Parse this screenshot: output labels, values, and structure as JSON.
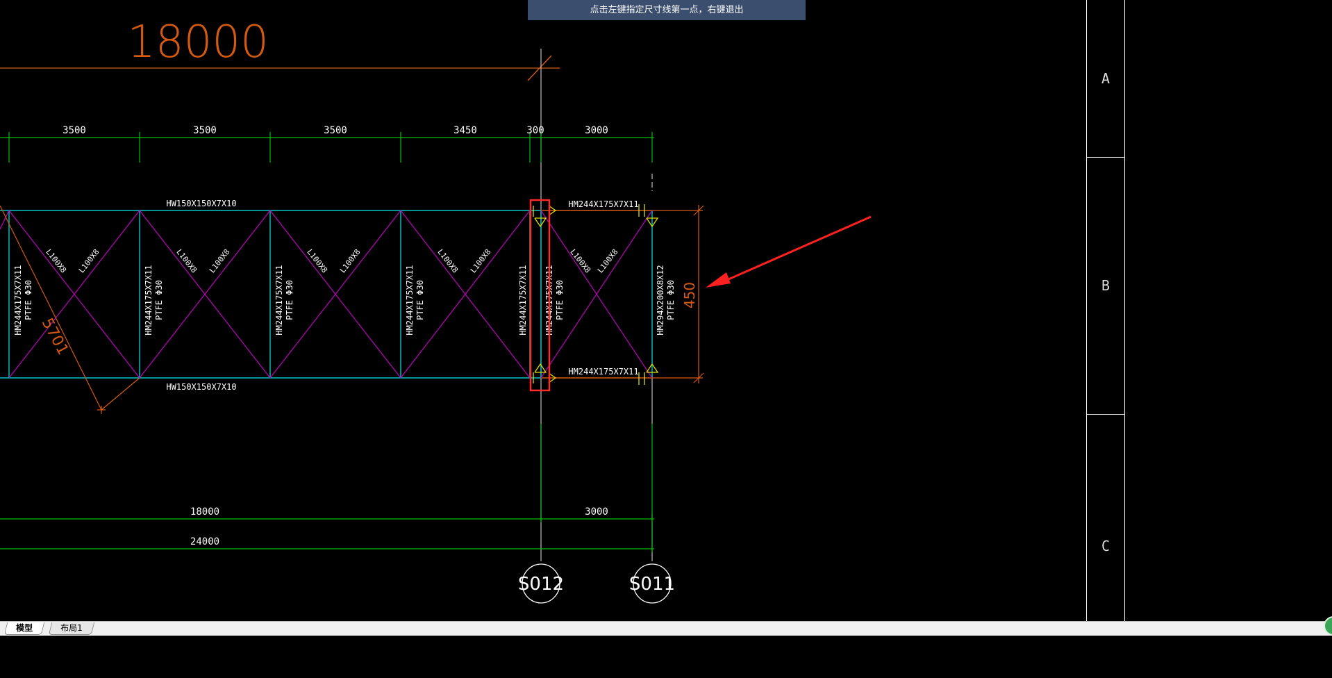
{
  "tooltip": "点击左键指定尺寸线第一点，右键退出",
  "drawing": {
    "top_dim": "18000",
    "bay_dims": [
      "3500",
      "3500",
      "3500",
      "3450",
      "300",
      "3000"
    ],
    "top_chord": "HW150X150X7X10",
    "bottom_chord": "HW150X150X7X10",
    "right_top_beam": "HM244X175X7X11",
    "right_bottom_beam": "HM244X175X7X11",
    "column_label": "HM244X175X7X11",
    "column_pad": "PTFE Φ30",
    "right_column_label": "HM294X200X8X12",
    "brace_label": "L100X8",
    "height_dim": "450",
    "diag_dim": "5701",
    "bottom_dim1": "18000",
    "bottom_dim2": "3000",
    "bottom_total": "24000",
    "axis_labels": [
      "S012",
      "S011"
    ]
  },
  "right_panel": {
    "rows": [
      "A",
      "B",
      "C"
    ]
  },
  "tabs": [
    {
      "label": "模型",
      "active": true
    },
    {
      "label": "布局1",
      "active": false
    }
  ],
  "colors": {
    "cyan": "#00c8c8",
    "magenta": "#c000c0",
    "green": "#00c000",
    "orange": "#d45a12",
    "yellow": "#e0e000",
    "highlight": "#ff2a2a"
  }
}
